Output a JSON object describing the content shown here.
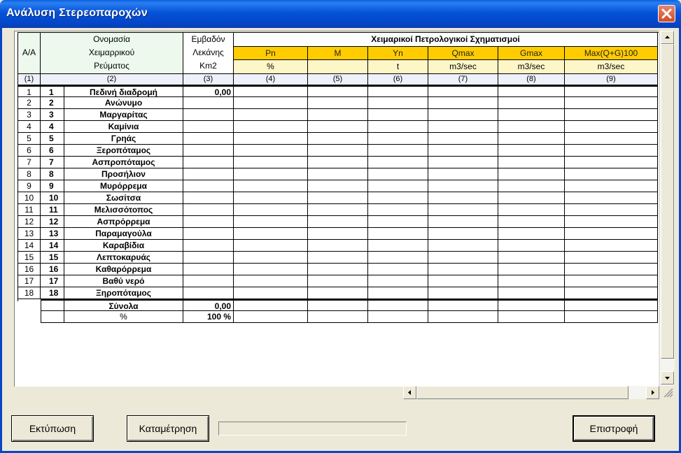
{
  "window": {
    "title": "Ανάλυση Στερεοπαροχών"
  },
  "header": {
    "aa": "Α/Α",
    "name_line1": "Ονομασία",
    "name_line2": "Χειμαρρικού",
    "name_line3": "Ρεύματος",
    "area_line1": "Εμβαδόν",
    "area_line2": "Λεκάνης",
    "area_unit": "Km2",
    "group_title": "Χειμαρικοί Πετρολογικοί Σχηματισμοί",
    "columns": [
      {
        "label": "Pn",
        "unit": "%"
      },
      {
        "label": "M",
        "unit": ""
      },
      {
        "label": "Yn",
        "unit": "t"
      },
      {
        "label": "Qmax",
        "unit": "m3/sec"
      },
      {
        "label": "Gmax",
        "unit": "m3/sec"
      },
      {
        "label": "Max(Q+G)100",
        "unit": "m3/sec"
      }
    ],
    "col_numbers": [
      "(1)",
      "(2)",
      "(3)",
      "(4)",
      "(5)",
      "(6)",
      "(7)",
      "(8)",
      "(9)"
    ]
  },
  "rows": [
    {
      "aa": "1",
      "num": "1",
      "name": "Πεδινή διαδρομή",
      "area": "0,00"
    },
    {
      "aa": "2",
      "num": "2",
      "name": "Ανώνυμο",
      "area": ""
    },
    {
      "aa": "3",
      "num": "3",
      "name": "Μαργαρίτας",
      "area": ""
    },
    {
      "aa": "4",
      "num": "4",
      "name": "Καμίνια",
      "area": ""
    },
    {
      "aa": "5",
      "num": "5",
      "name": "Γρηάς",
      "area": ""
    },
    {
      "aa": "6",
      "num": "6",
      "name": "Ξεροπόταμος",
      "area": ""
    },
    {
      "aa": "7",
      "num": "7",
      "name": "Ασπροπόταμος",
      "area": ""
    },
    {
      "aa": "8",
      "num": "8",
      "name": "Προσήλιον",
      "area": ""
    },
    {
      "aa": "9",
      "num": "9",
      "name": "Μυρόρρεμα",
      "area": ""
    },
    {
      "aa": "10",
      "num": "10",
      "name": "Σωσίτσα",
      "area": ""
    },
    {
      "aa": "11",
      "num": "11",
      "name": "Μελισσότοπος",
      "area": ""
    },
    {
      "aa": "12",
      "num": "12",
      "name": "Ασπρόρρεμα",
      "area": ""
    },
    {
      "aa": "13",
      "num": "13",
      "name": "Παραμαγούλα",
      "area": ""
    },
    {
      "aa": "14",
      "num": "14",
      "name": "Καραβίδια",
      "area": ""
    },
    {
      "aa": "15",
      "num": "15",
      "name": "Λεπτοκαρυάς",
      "area": ""
    },
    {
      "aa": "16",
      "num": "16",
      "name": "Καθαρόρρεμα",
      "area": ""
    },
    {
      "aa": "17",
      "num": "17",
      "name": "Βαθύ νερό",
      "area": ""
    },
    {
      "aa": "18",
      "num": "18",
      "name": "Ξηροπόταμος",
      "area": ""
    }
  ],
  "totals": {
    "label": "Σύνολα",
    "area": "0,00"
  },
  "percent": {
    "label": "%",
    "area": "100 %"
  },
  "buttons": {
    "print": "Εκτύπωση",
    "count": "Καταμέτρηση",
    "back": "Επιστροφή"
  },
  "progress": {
    "value": 0
  }
}
